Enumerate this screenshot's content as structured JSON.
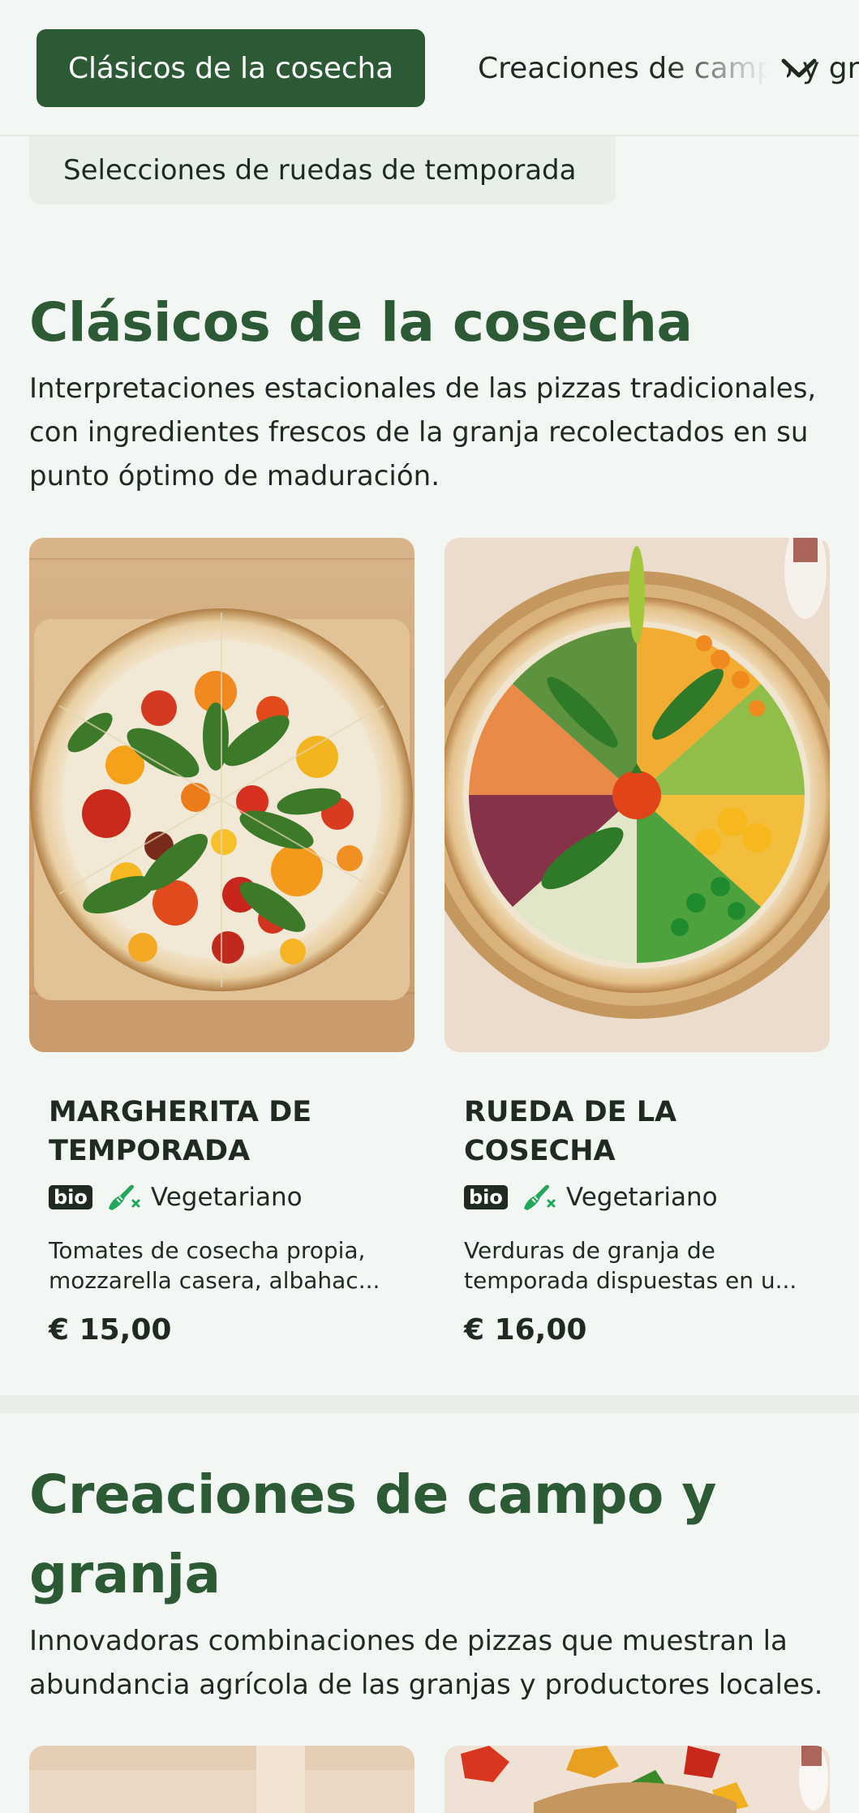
{
  "tabs": {
    "active_label": "Clásicos de la cosecha",
    "next_label": "Creaciones de campo y granja",
    "second_row_label": "Selecciones de ruedas de temporada"
  },
  "sections": [
    {
      "title": "Clásicos de la cosecha",
      "description": "Interpretaciones estacionales de las pizzas tradicionales, con ingredientes frescos de la granja recolectados en su punto óptimo de maduración.",
      "items": [
        {
          "name_line1": "MARGHERITA DE",
          "name_line2": "TEMPORADA",
          "badge": "bio",
          "diet": "Vegetariano",
          "desc_line1": "Tomates de cosecha propia,",
          "desc_line2": "mozzarella casera, albahac...",
          "price": "€ 15,00"
        },
        {
          "name_line1": "RUEDA DE LA COSECHA",
          "badge": "bio",
          "diet": "Vegetariano",
          "desc_line1": "Verduras de granja de",
          "desc_line2": "temporada dispuestas en u...",
          "price": "€ 16,00"
        }
      ]
    },
    {
      "title_line1": "Creaciones de campo y",
      "title_line2": "granja",
      "description": "Innovadoras combinaciones de pizzas que muestran la abundancia agrícola de las granjas y productores locales."
    }
  ],
  "colors": {
    "brand_green": "#2c5a35",
    "background": "#f3f7f3",
    "veg_icon": "#1fa85a"
  }
}
